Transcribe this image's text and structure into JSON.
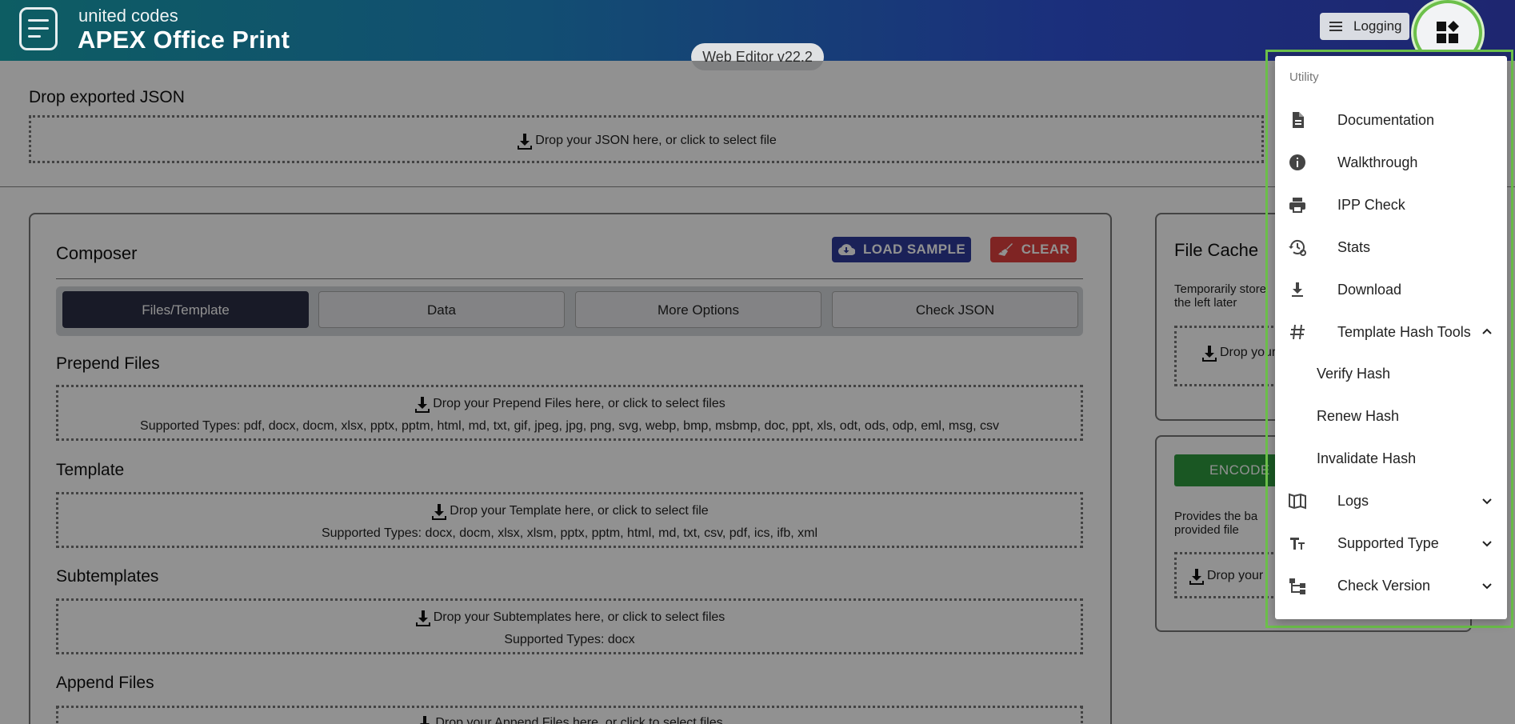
{
  "header": {
    "brand_small": "united codes",
    "brand_big": "APEX Office Print",
    "logging_label": "Logging",
    "apps_button_icon": "apps-grid-icon"
  },
  "version": "Web Editor v22.2",
  "drop_json": {
    "title": "Drop exported JSON",
    "zone_text": "Drop your JSON here, or click to select file"
  },
  "composer": {
    "title": "Composer",
    "load_sample": "LOAD SAMPLE",
    "clear": "CLEAR",
    "tabs": [
      "Files/Template",
      "Data",
      "More Options",
      "Check JSON"
    ],
    "active_tab": "Files/Template",
    "sections": [
      {
        "title": "Prepend Files",
        "zone": "Drop your Prepend Files here, or click to select files",
        "types": "Supported Types: pdf, docx, docm, xlsx, pptx, pptm, html, md, txt, gif, jpeg, jpg, png, svg, webp, bmp, msbmp, doc, ppt, xls, odt, ods, odp, eml, msg, csv"
      },
      {
        "title": "Template",
        "zone": "Drop your Template here, or click to select file",
        "types": "Supported Types: docx, docm, xlsx, xlsm, pptx, pptm, html, md, txt, csv, pdf, ics, ifb, xml"
      },
      {
        "title": "Subtemplates",
        "zone": "Drop your Subtemplates here, or click to select files",
        "types": "Supported Types: docx"
      },
      {
        "title": "Append Files",
        "zone": "Drop your Append Files here, or click to select files",
        "types": ""
      }
    ]
  },
  "file_cache": {
    "title": "File Cache",
    "desc_line1": "Temporarily store",
    "desc_line2": "the left later",
    "zone": "Drop your"
  },
  "encode": {
    "button": "ENCODE",
    "desc_line1": "Provides the ba",
    "desc_line2": "provided file",
    "zone": "Drop your"
  },
  "menu": {
    "subheader": "Utility",
    "items": [
      {
        "label": "Documentation",
        "icon": "document-icon"
      },
      {
        "label": "Walkthrough",
        "icon": "info-icon"
      },
      {
        "label": "IPP Check",
        "icon": "printer-icon"
      },
      {
        "label": "Stats",
        "icon": "history-settings-icon"
      },
      {
        "label": "Download",
        "icon": "download-icon"
      },
      {
        "label": "Template Hash Tools",
        "icon": "hash-icon",
        "expanded": true
      },
      {
        "label": "Verify Hash"
      },
      {
        "label": "Renew Hash"
      },
      {
        "label": "Invalidate Hash"
      },
      {
        "label": "Logs",
        "icon": "map-book-icon",
        "expanded": false
      },
      {
        "label": "Supported Type",
        "icon": "text-size-icon",
        "expanded": false
      },
      {
        "label": "Check Version",
        "icon": "tree-icon",
        "expanded": false
      }
    ]
  },
  "colors": {
    "header_start": "#0d5d63",
    "header_end": "#1e2670",
    "load_button": "#2f3a9c",
    "clear_button": "#e0403e",
    "encode_button": "#2e9a3e",
    "highlight": "#6cc04a"
  }
}
